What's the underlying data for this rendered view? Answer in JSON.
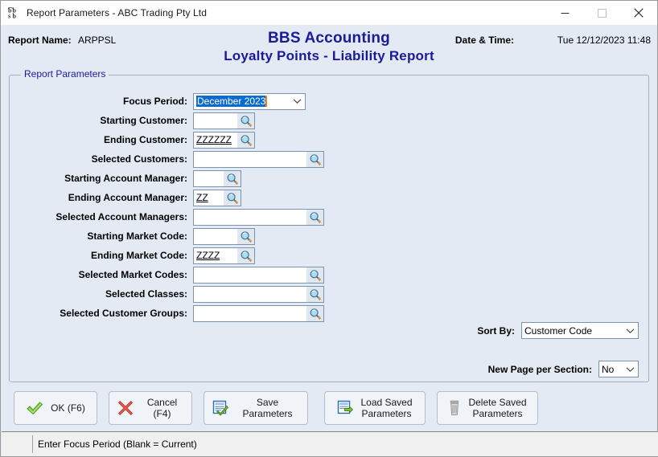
{
  "window": {
    "title": "Report Parameters - ABC Trading Pty Ltd",
    "app_icon": "bbs-logo-icon",
    "minimize_icon": "minimize-icon",
    "maximize_icon": "maximize-icon",
    "close_icon": "close-icon"
  },
  "header": {
    "report_name_label": "Report Name:",
    "report_name_value": "ARPPSL",
    "title": "BBS Accounting",
    "subtitle": "Loyalty Points - Liability Report",
    "datetime_label": "Date & Time:",
    "datetime_value": "Tue 12/12/2023 11:48",
    "title_color": "#1a1a9c"
  },
  "group": {
    "legend": "Report Parameters"
  },
  "fields": [
    {
      "label": "Focus Period:",
      "type": "combo",
      "value": "December 2023",
      "selected": true,
      "width": "combo"
    },
    {
      "label": "Starting Customer:",
      "type": "lookup",
      "value": "",
      "width": "short",
      "icon": "magnifier-icon"
    },
    {
      "label": "Ending Customer:",
      "type": "lookup",
      "value": "ZZZZZZ",
      "width": "short",
      "icon": "magnifier-icon"
    },
    {
      "label": "Selected Customers:",
      "type": "lookup",
      "value": "",
      "width": "long",
      "icon": "magnifier-icon"
    },
    {
      "label": "Starting Account Manager:",
      "type": "lookup",
      "value": "",
      "width": "mid",
      "icon": "magnifier-icon"
    },
    {
      "label": "Ending Account Manager:",
      "type": "lookup",
      "value": "ZZ",
      "width": "mid",
      "icon": "magnifier-icon"
    },
    {
      "label": "Selected Account Managers:",
      "type": "lookup",
      "value": "",
      "width": "long",
      "icon": "magnifier-icon"
    },
    {
      "label": "Starting Market Code:",
      "type": "lookup",
      "value": "",
      "width": "short",
      "icon": "magnifier-icon"
    },
    {
      "label": "Ending Market Code:",
      "type": "lookup",
      "value": "ZZZZ",
      "width": "short",
      "icon": "magnifier-icon"
    },
    {
      "label": "Selected Market Codes:",
      "type": "lookup",
      "value": "",
      "width": "long",
      "icon": "magnifier-icon"
    },
    {
      "label": "Selected Classes:",
      "type": "lookup",
      "value": "",
      "width": "long",
      "icon": "magnifier-icon"
    },
    {
      "label": "Selected Customer Groups:",
      "type": "lookup",
      "value": "",
      "width": "long",
      "icon": "magnifier-icon"
    }
  ],
  "sort_by": {
    "label": "Sort By:",
    "value": "Customer Code"
  },
  "new_page": {
    "label": "New Page per Section:",
    "value": "No"
  },
  "buttons": {
    "ok": {
      "label": "OK (F6)",
      "icon": "green-check-icon"
    },
    "cancel": {
      "label": "Cancel (F4)",
      "icon": "red-cross-icon"
    },
    "save": {
      "label": "Save Parameters",
      "icon": "save-document-icon"
    },
    "load": {
      "label": "Load Saved\nParameters",
      "icon": "load-document-icon"
    },
    "delete": {
      "label": "Delete Saved\nParameters",
      "icon": "trash-can-icon"
    }
  },
  "status": {
    "message": "Enter Focus Period (Blank = Current)"
  }
}
